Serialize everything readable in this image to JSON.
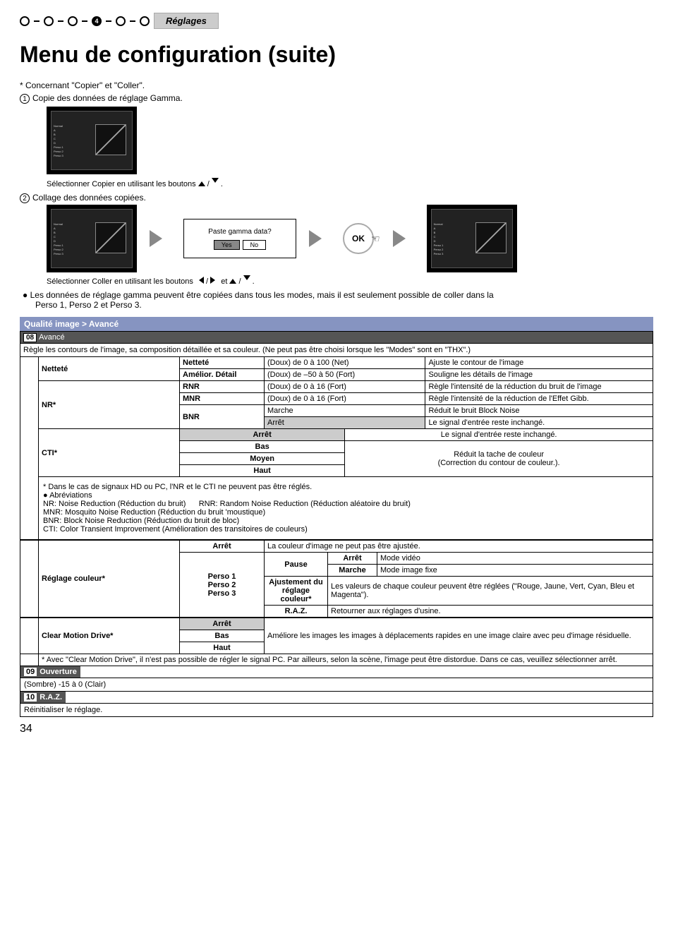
{
  "header": {
    "step_active": "4",
    "tab": "Réglages"
  },
  "title": "Menu de configuration (suite)",
  "pre": {
    "intro": "* Concernant \"Copier\" et \"Coller\".",
    "step1": "Copie des données de réglage Gamma.",
    "caption1_a": "Sélectionner Copier en utilisant les boutons ",
    "caption1_b": " / ",
    "caption1_c": " .",
    "step2": "Collage des données copiées.",
    "paste_q": "Paste gamma data?",
    "yes": "Yes",
    "no": "No",
    "ok": "OK",
    "caption2_a": "Sélectionner Coller en utilisant les boutons ",
    "caption2_b": " / ",
    "caption2_c": " et ",
    "caption2_d": " / ",
    "caption2_e": " .",
    "bullet": "Les données de réglage gamma peuvent être copiées dans tous les modes, mais il est seulement possible de coller dans la",
    "bullet2": "Perso 1, Perso 2 et Perso 3."
  },
  "section": {
    "bar": "Qualité image > Avancé",
    "sub_num": "08",
    "sub_label": "Avancé",
    "desc": "Règle les contours de l'image, sa composition détaillée et sa couleur. (Ne peut pas être choisi lorsque les \"Modes\" sont en \"THX\".)"
  },
  "nettete": {
    "row_label": "Netteté",
    "r1_sub": "Netteté",
    "r1_val": "(Doux) de 0 à 100 (Net)",
    "r1_desc": "Ajuste le contour de l'image",
    "r2_sub": "Amélior. Détail",
    "r2_val": "(Doux) de –50 à 50 (Fort)",
    "r2_desc": "Souligne les détails de l'image"
  },
  "nr": {
    "row_label": "NR*",
    "rnr_sub": "RNR",
    "rnr_val": "(Doux) de 0 à 16 (Fort)",
    "rnr_desc": "Règle l'intensité de la réduction du bruit de l'image",
    "mnr_sub": "MNR",
    "mnr_val": "(Doux) de 0 à 16 (Fort)",
    "mnr_desc": "Règle l'intensité de la réduction de l'Effet Gibb.",
    "bnr_sub": "BNR",
    "bnr_on_val": "Marche",
    "bnr_on_desc": "Réduit le bruit Block Noise",
    "bnr_off_val": "Arrêt",
    "bnr_off_desc": "Le signal d'entrée reste inchangé."
  },
  "cti": {
    "row_label": "CTI*",
    "arret": "Arrêt",
    "arret_desc": "Le signal d'entrée reste inchangé.",
    "bas": "Bas",
    "moyen": "Moyen",
    "haut": "Haut",
    "reduce_desc": "Réduit la tache de couleur\n(Correction du contour de couleur.)."
  },
  "notes": {
    "hd": "*  Dans le cas de signaux HD ou PC, l'NR et le CTI ne peuvent pas être réglés.",
    "ab": "Abréviations",
    "nr": "NR: Noise Reduction (Réduction du bruit)",
    "rnr": "RNR: Random Noise Reduction (Réduction aléatoire du bruit)",
    "mnr": "MNR: Mosquito Noise Reduction (Réduction du bruit 'moustique)",
    "bnr": "BNR: Block Noise Reduction (Réduction du bruit de bloc)",
    "cti": "CTI: Color Transient Improvement (Amélioration des transitoires de couleurs)"
  },
  "reglage": {
    "row_label": "Réglage couleur*",
    "arret_sub": "Arrêt",
    "arret_val": "La couleur d'image ne peut pas être ajustée.",
    "persos": "Perso 1\nPerso 2\nPerso 3",
    "pause": "Pause",
    "pause_off": "Arrêt",
    "pause_off_d": "Mode vidéo",
    "pause_on": "Marche",
    "pause_on_d": "Mode image fixe",
    "ajust": "Ajustement du réglage couleur*",
    "ajust_d": "Les valeurs de chaque couleur peuvent être réglées (\"Rouge, Jaune, Vert, Cyan, Bleu et Magenta\").",
    "raz": "R.A.Z.",
    "raz_d": "Retourner aux réglages d'usine."
  },
  "cmd": {
    "row_label": "Clear Motion Drive*",
    "arret": "Arrêt",
    "bas": "Bas",
    "haut": "Haut",
    "desc": "Améliore les images les images à déplacements rapides en une image claire avec peu d'image résiduelle.",
    "note": "* Avec \"Clear Motion Drive\", il n'est pas possible de régler le signal PC. Par ailleurs, selon la scène, l'image peut être distordue. Dans ce cas, veuillez sélectionner arrêt."
  },
  "ouverture": {
    "num": "09",
    "label": "Ouverture",
    "desc": "(Sombre) -15 à 0 (Clair)"
  },
  "raz_section": {
    "num": "10",
    "label": "R.A.Z.",
    "desc": "Réinitialiser le réglage."
  },
  "page": "34"
}
